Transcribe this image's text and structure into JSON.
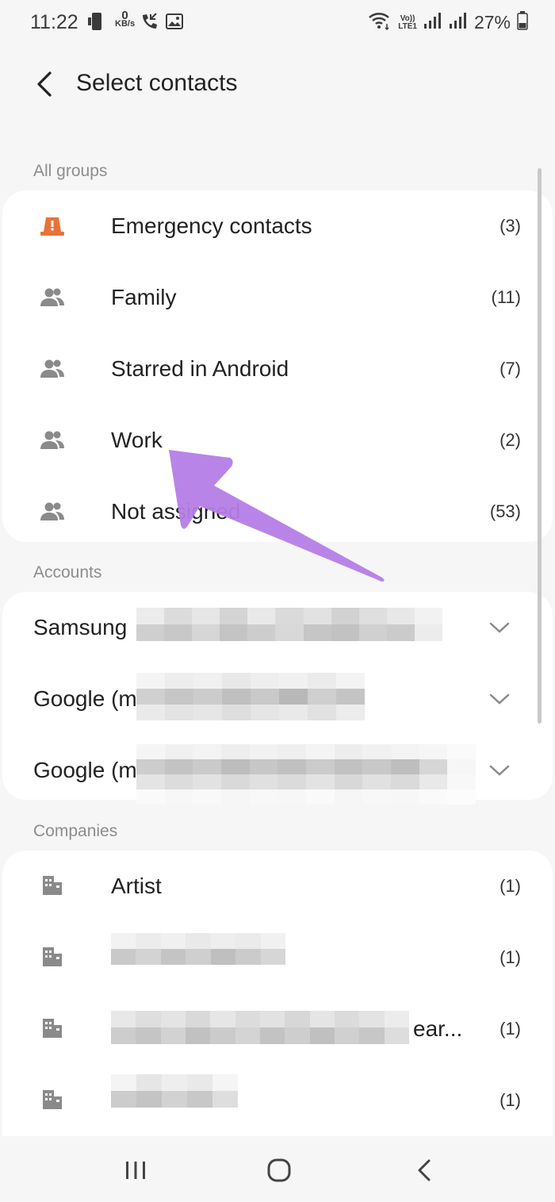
{
  "status_bar": {
    "time": "11:22",
    "net_speed_value": "0",
    "net_speed_unit": "KB/s",
    "volte_top": "Vo))",
    "volte_bottom": "LTE1",
    "battery": "27%"
  },
  "header": {
    "title": "Select contacts"
  },
  "groups": {
    "title": "All groups",
    "items": [
      {
        "label": "Emergency contacts",
        "count": "(3)",
        "icon": "emergency-icon"
      },
      {
        "label": "Family",
        "count": "(11)",
        "icon": "people-icon"
      },
      {
        "label": "Starred in Android",
        "count": "(7)",
        "icon": "people-icon"
      },
      {
        "label": "Work",
        "count": "(2)",
        "icon": "people-icon"
      },
      {
        "label": "Not assigned",
        "count": "(53)",
        "icon": "people-icon"
      }
    ]
  },
  "accounts": {
    "title": "Accounts",
    "items": [
      {
        "label": "Samsung",
        "icon": "chevron-down-icon"
      },
      {
        "label": "Google (m",
        "icon": "chevron-down-icon"
      },
      {
        "label": "Google (m",
        "icon": "chevron-down-icon"
      }
    ]
  },
  "companies": {
    "title": "Companies",
    "items": [
      {
        "label": "Artist",
        "count": "(1)",
        "icon": "building-icon"
      },
      {
        "label": "",
        "count": "(1)",
        "icon": "building-icon"
      },
      {
        "label": "ear...",
        "count": "(1)",
        "icon": "building-icon"
      },
      {
        "label": "",
        "count": "(1)",
        "icon": "building-icon"
      }
    ]
  },
  "colors": {
    "emergency": "#e8733a",
    "icon_gray": "#8a8a8a",
    "arrow": "#b57de6",
    "card": "#ffffff",
    "background": "#f6f6f6"
  }
}
